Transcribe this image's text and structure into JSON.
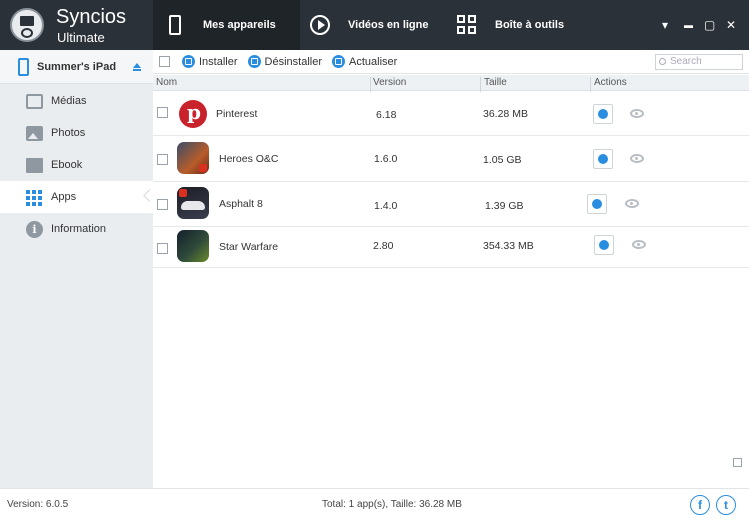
{
  "app": {
    "name": "Syncios",
    "edition": "Ultimate"
  },
  "nav": {
    "tabs": [
      {
        "label": "Mes appareils",
        "icon": "phone-icon",
        "active": true
      },
      {
        "label": "Vidéos en ligne",
        "icon": "play-icon",
        "active": false
      },
      {
        "label": "Boîte à outils",
        "icon": "grid-icon",
        "active": false
      }
    ],
    "window_controls": {
      "menu": "▾",
      "minimize": "▬",
      "maximize": "▢",
      "close": "✕"
    }
  },
  "sidebar": {
    "device": "Summer's iPad",
    "items": [
      {
        "label": "Médias",
        "icon": "tv-icon"
      },
      {
        "label": "Photos",
        "icon": "photo-icon"
      },
      {
        "label": "Ebook",
        "icon": "book-icon"
      },
      {
        "label": "Apps",
        "icon": "apps-icon",
        "active": true
      },
      {
        "label": "Information",
        "icon": "info-icon"
      }
    ]
  },
  "toolbar": {
    "install": "Installer",
    "uninstall": "Désinstaller",
    "refresh": "Actualiser",
    "search_placeholder": "Search"
  },
  "table": {
    "headers": {
      "name": "Nom",
      "version": "Version",
      "size": "Taille",
      "actions": "Actions"
    },
    "rows": [
      {
        "name": "Pinterest",
        "version": "6.18",
        "size": "36.28 MB",
        "icon": "pinterest-icon"
      },
      {
        "name": "Heroes O&C",
        "version": "1.6.0",
        "size": "1.05 GB",
        "icon": "heroes-icon"
      },
      {
        "name": "Asphalt 8",
        "version": "1.4.0",
        "size": "1.39 GB",
        "icon": "asphalt-icon"
      },
      {
        "name": "Star Warfare",
        "version": "2.80",
        "size": "354.33 MB",
        "icon": "star-warfare-icon"
      }
    ]
  },
  "footer": {
    "version": "Version: 6.0.5",
    "total": "Total: 1 app(s), Taille: 36.28 MB",
    "facebook": "f",
    "twitter": "t"
  },
  "colors": {
    "header_bg": "#2b3138",
    "accent": "#2a8ee0",
    "sidebar_bg": "#e9edf0"
  }
}
